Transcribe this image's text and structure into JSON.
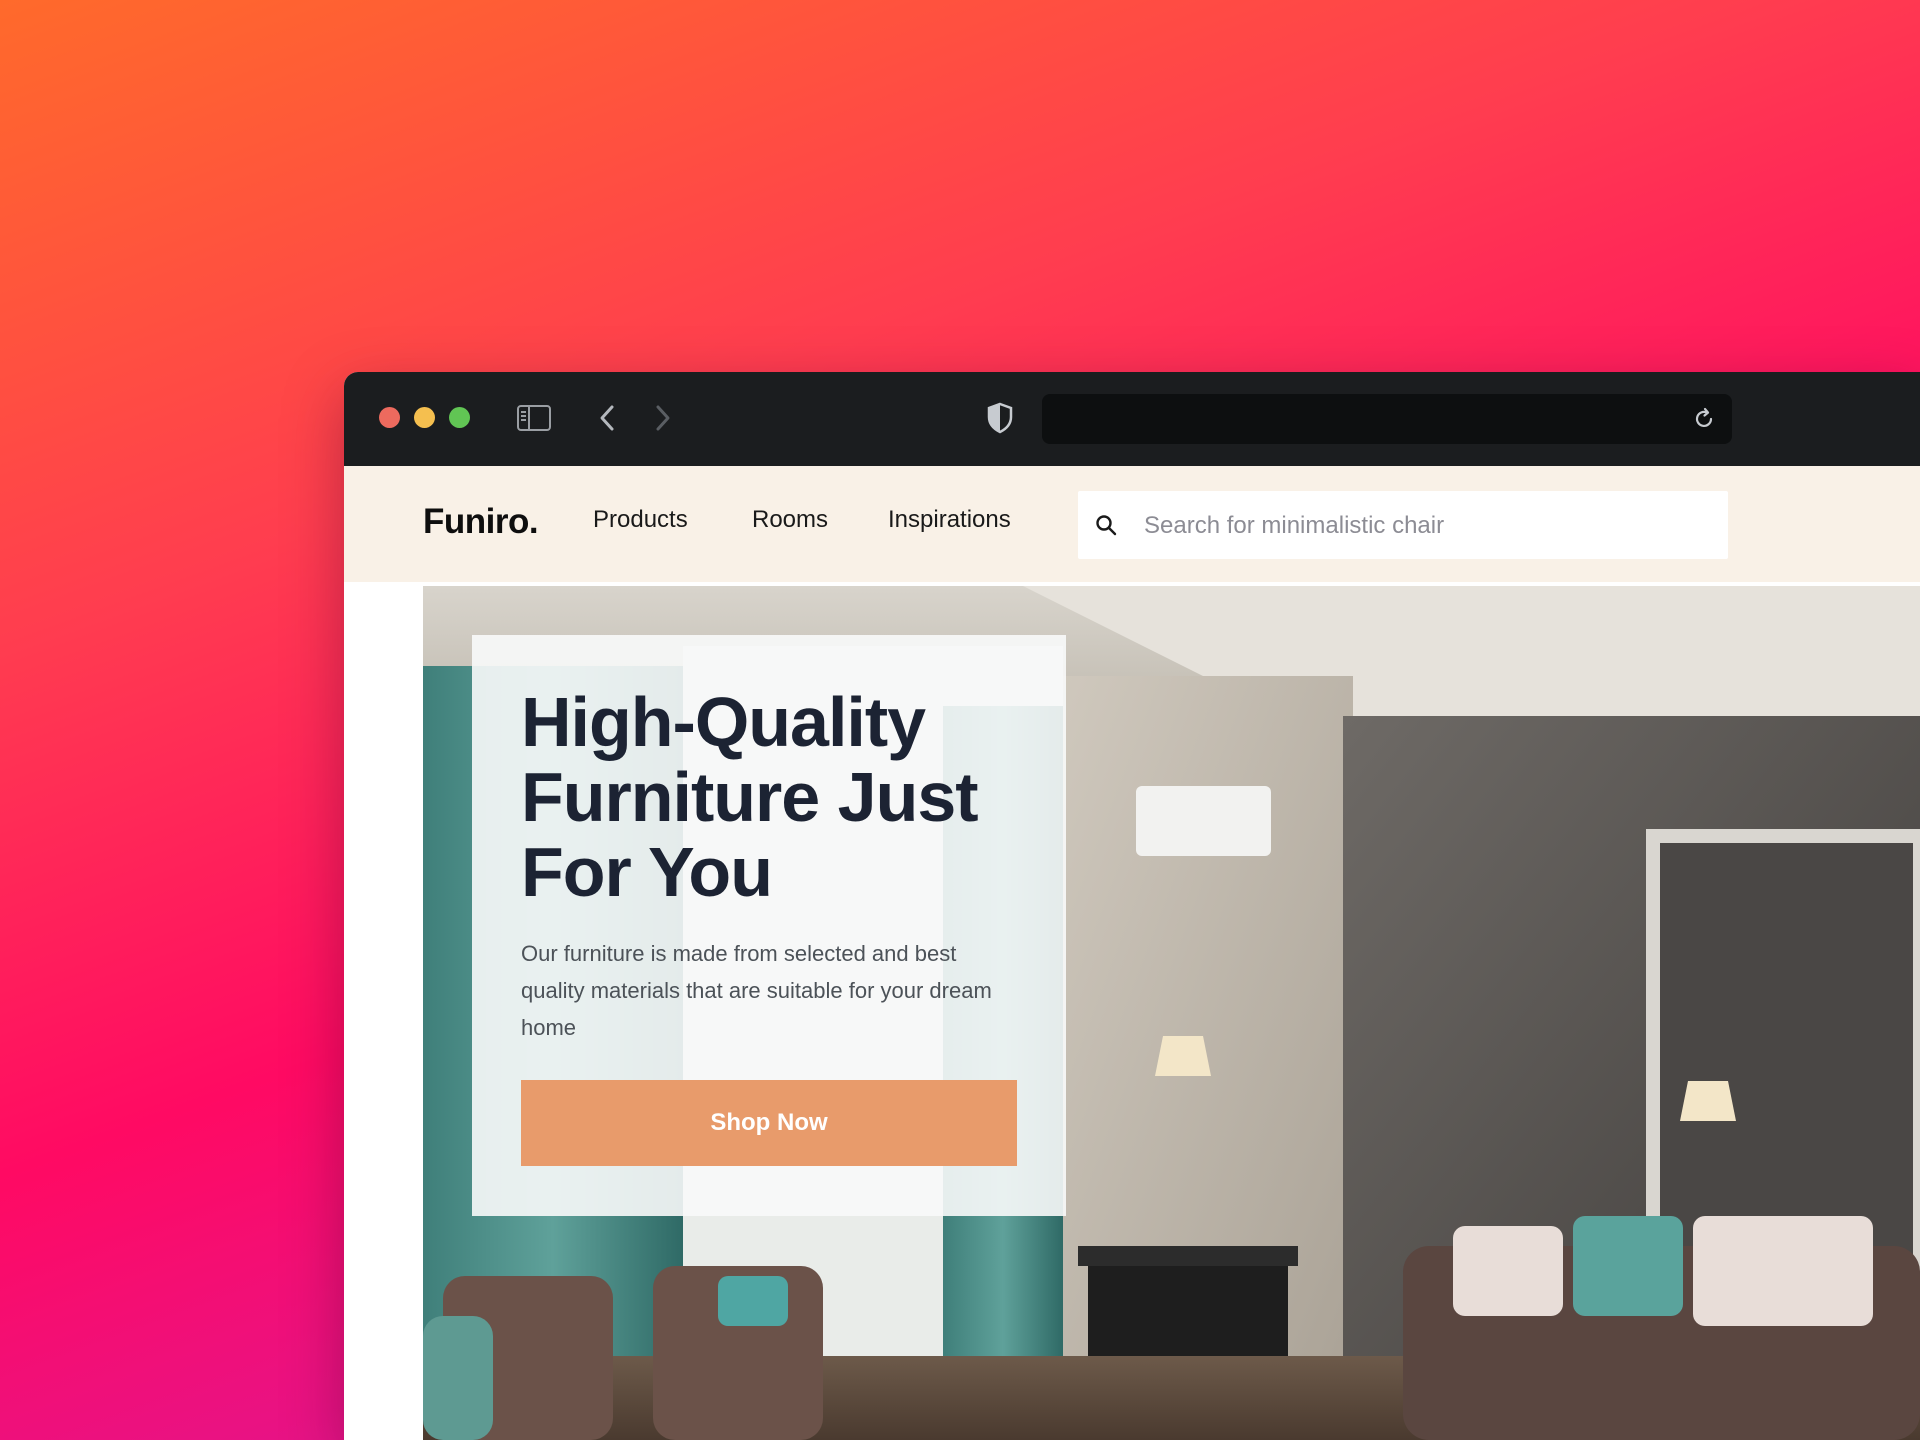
{
  "browser": {
    "icons": {
      "sidebar": "sidebar-toggle-icon",
      "back": "chevron-left-icon",
      "forward": "chevron-right-icon",
      "shield": "shield-icon",
      "reload": "reload-icon"
    },
    "url": ""
  },
  "header": {
    "logo": "Funiro.",
    "nav": [
      "Products",
      "Rooms",
      "Inspirations"
    ],
    "search": {
      "placeholder": "Search for minimalistic chair",
      "icon": "search-icon"
    }
  },
  "hero": {
    "title": "High-Quality Furniture Just For You",
    "description": "Our furniture is made from selected and best quality materials that are suitable for your dream home",
    "cta_label": "Shop Now"
  },
  "colors": {
    "header_bg": "#f9f1e7",
    "cta": "#e89b6b",
    "title_text": "#1c2333",
    "titlebar": "#1b1d1f"
  }
}
